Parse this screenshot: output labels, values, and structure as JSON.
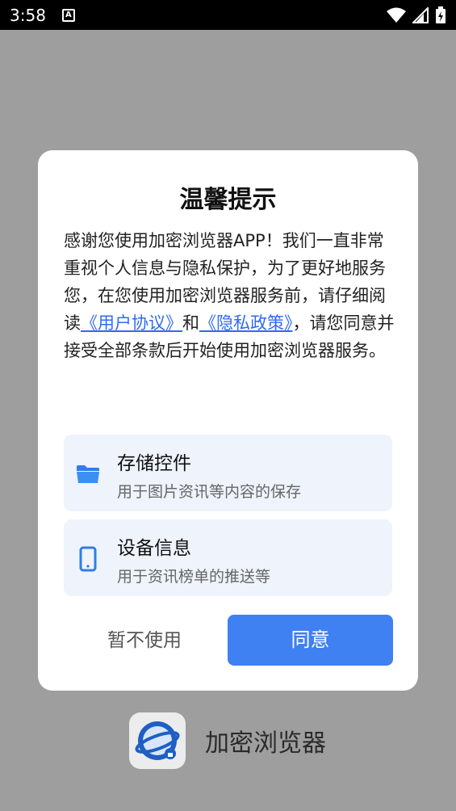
{
  "status_bar": {
    "time": "3:58",
    "notification_icon_letter": "A",
    "icons": [
      "wifi-icon",
      "cellular-icon",
      "battery-charging-icon"
    ]
  },
  "dialog": {
    "title": "温馨提示",
    "body_prefix": "感谢您使用加密浏览器APP！我们一直非常重视个人信息与隐私保护，为了更好地服务您，在您使用加密浏览器服务前，请仔细阅读",
    "link_user_agreement": "《用户协议》",
    "body_and": "和",
    "link_privacy_policy": "《隐私政策》",
    "body_suffix": "，请您同意并接受全部条款后开始使用加密浏览器服务。",
    "link_color": "#2f6bf0",
    "permissions": [
      {
        "icon": "folder-icon",
        "title": "存储控件",
        "desc": "用于图片资讯等内容的保存"
      },
      {
        "icon": "phone-icon",
        "title": "设备信息",
        "desc": "用于资讯榜单的推送等"
      }
    ],
    "decline_label": "暂不使用",
    "agree_label": "同意",
    "accent_color": "#3f80f2"
  },
  "background_app": {
    "name": "加密浏览器",
    "logo_icon": "planet-lock-icon"
  }
}
